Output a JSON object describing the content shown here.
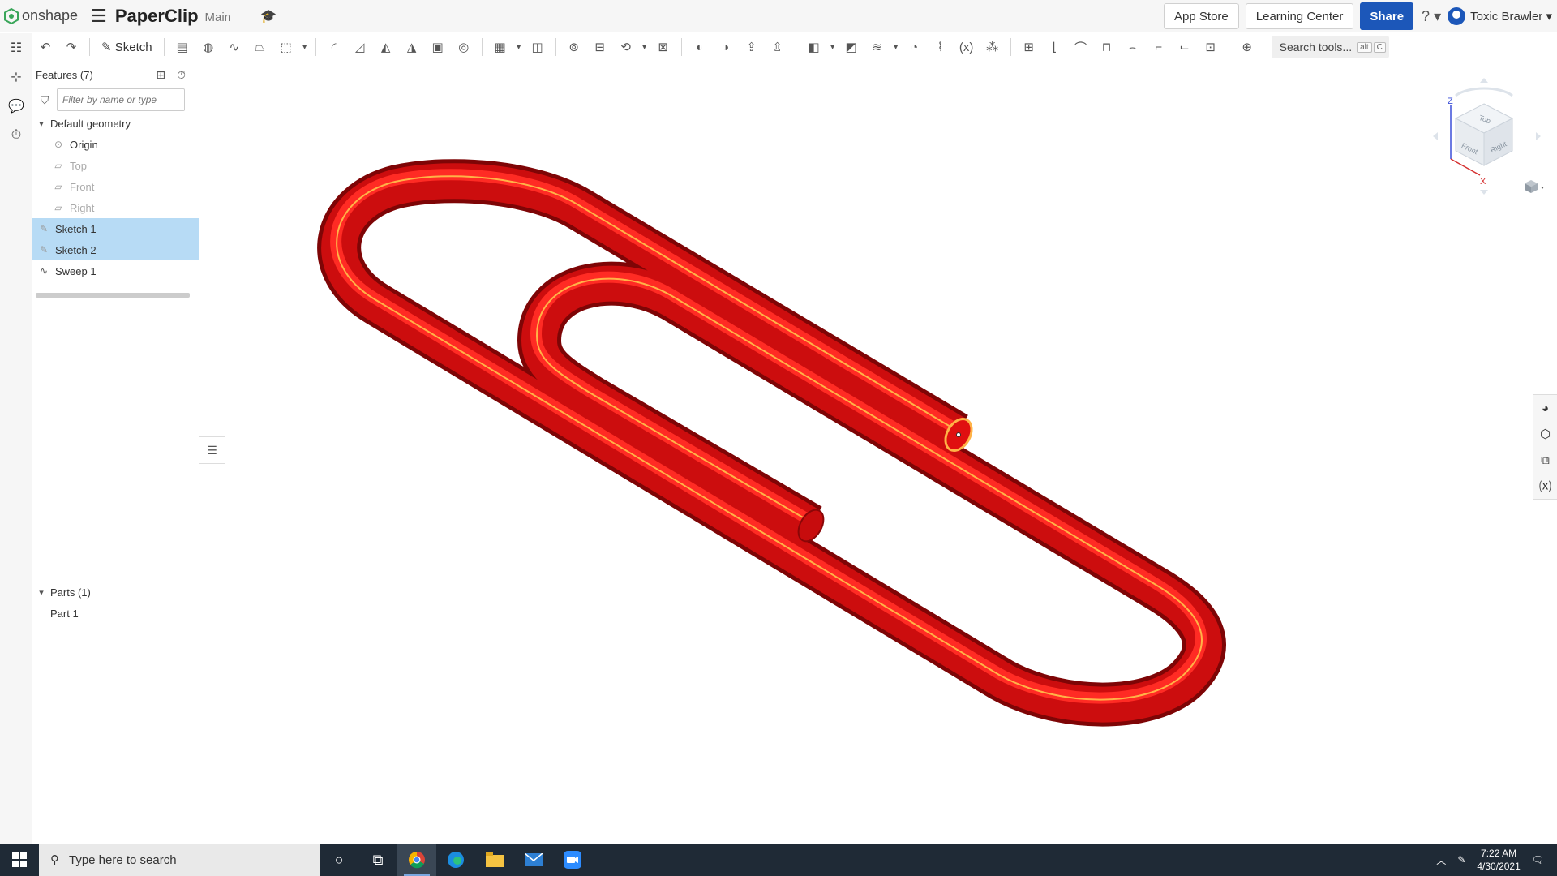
{
  "app": {
    "brand": "onshape",
    "doc_title": "PaperClip",
    "branch": "Main"
  },
  "header": {
    "app_store": "App Store",
    "learning_center": "Learning Center",
    "share": "Share",
    "help_icon": "?",
    "user_name": "Toxic Brawler"
  },
  "toolbar": {
    "sketch_label": "Sketch",
    "search_label": "Search tools...",
    "shortcut_alt": "alt",
    "shortcut_key": "C"
  },
  "panel": {
    "features_title": "Features (7)",
    "filter_placeholder": "Filter by name or type",
    "default_geometry": "Default geometry",
    "origin": "Origin",
    "planes": [
      "Top",
      "Front",
      "Right"
    ],
    "features": [
      {
        "label": "Sketch 1",
        "selected": true
      },
      {
        "label": "Sketch 2",
        "selected": true
      },
      {
        "label": "Sweep 1",
        "selected": false
      }
    ],
    "parts_title": "Parts (1)",
    "parts": [
      "Part 1"
    ]
  },
  "viewcube": {
    "z": "Z",
    "x": "X",
    "top": "Top",
    "front": "Front",
    "right": "Right"
  },
  "colors": {
    "accent": "#1c57b9",
    "selection": "#b7dbf5",
    "model_red": "#d40f10",
    "highlight": "#ffb347"
  },
  "taskbar": {
    "search_placeholder": "Type here to search",
    "time": "7:22 AM",
    "date": "4/30/2021"
  }
}
